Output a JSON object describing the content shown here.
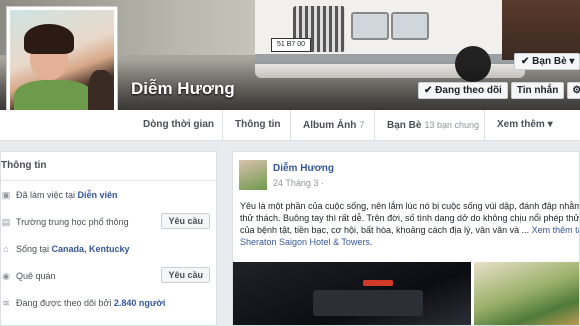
{
  "profile": {
    "name": "Diễm Hương"
  },
  "cover": {
    "plate": "51 B7 00"
  },
  "actions": {
    "friend_label": "Bạn Bè",
    "follow_label": "Đang theo dõi",
    "message_label": "Tin nhắn"
  },
  "tabs": [
    {
      "label": "Dòng thời gian"
    },
    {
      "label": "Thông tin"
    },
    {
      "label": "Album Ảnh",
      "count": "7"
    },
    {
      "label": "Bạn Bè",
      "count": "13 bạn chung"
    },
    {
      "label": "Xem thêm"
    }
  ],
  "info": {
    "heading": "Thông tin",
    "rows": [
      {
        "prefix": "Đã làm việc tại ",
        "value": "Diễn viên"
      },
      {
        "prefix": "Trường trung học phổ thông",
        "value": "",
        "button": "Yêu cầu"
      },
      {
        "prefix": "Sống tại ",
        "value": "Canada, Kentucky"
      },
      {
        "prefix": "Quê quán",
        "value": "",
        "button": "Yêu cầu"
      },
      {
        "prefix": "Đang được theo dõi bởi ",
        "value": "2.840 người"
      }
    ]
  },
  "post": {
    "author": "Diễm Hương",
    "time": "24 Tháng 3",
    "text": "Yêu là một phần của cuộc sống, nên lắm lúc nó bị cuộc sống vùi dập, đánh đập nhằm thử thách. Buông tay thì rất dễ. Trên đời, số tình dang dở do không chịu nổi phép thử của bệnh tật, tiền bạc, cơ hội, bất hòa, khoảng cách địa lý, vân vân và ...",
    "more_label": "Xem thêm",
    "location": "tại Sheraton Saigon Hotel & Towers."
  },
  "colors": {
    "link": "#365899",
    "page_bg": "#e9ebee"
  }
}
